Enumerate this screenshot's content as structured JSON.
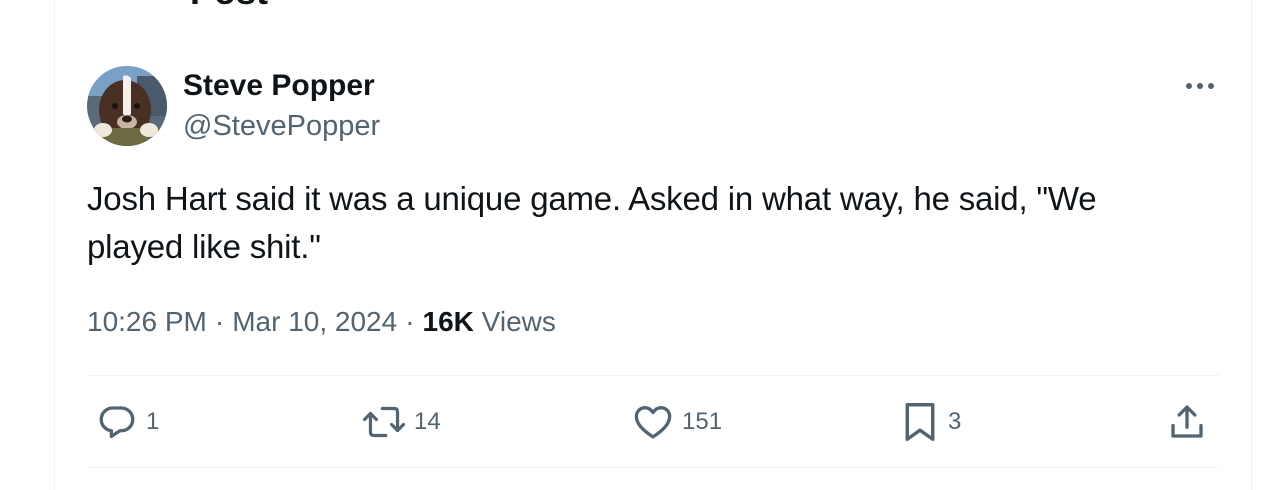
{
  "header": {
    "title": "Post",
    "back_icon": "arrow-left-icon"
  },
  "author": {
    "display_name": "Steve Popper",
    "handle": "@StevePopper",
    "avatar": "dog-avatar"
  },
  "tweet": {
    "text": "Josh Hart said it was a unique game. Asked in what way, he said, \"We played like shit.\"",
    "time": "10:26 PM",
    "separator": "·",
    "date": "Mar 10, 2024",
    "views_count": "16K",
    "views_label": "Views"
  },
  "actions": {
    "replies": "1",
    "reposts": "14",
    "likes": "151",
    "bookmarks": "3"
  },
  "colors": {
    "text_primary": "#0f1419",
    "text_secondary": "#536471",
    "divider": "#eff3f4"
  },
  "icons": {
    "more": "more-horizontal-icon",
    "reply": "reply-icon",
    "repost": "repost-icon",
    "like": "heart-icon",
    "bookmark": "bookmark-icon",
    "share": "share-icon"
  }
}
